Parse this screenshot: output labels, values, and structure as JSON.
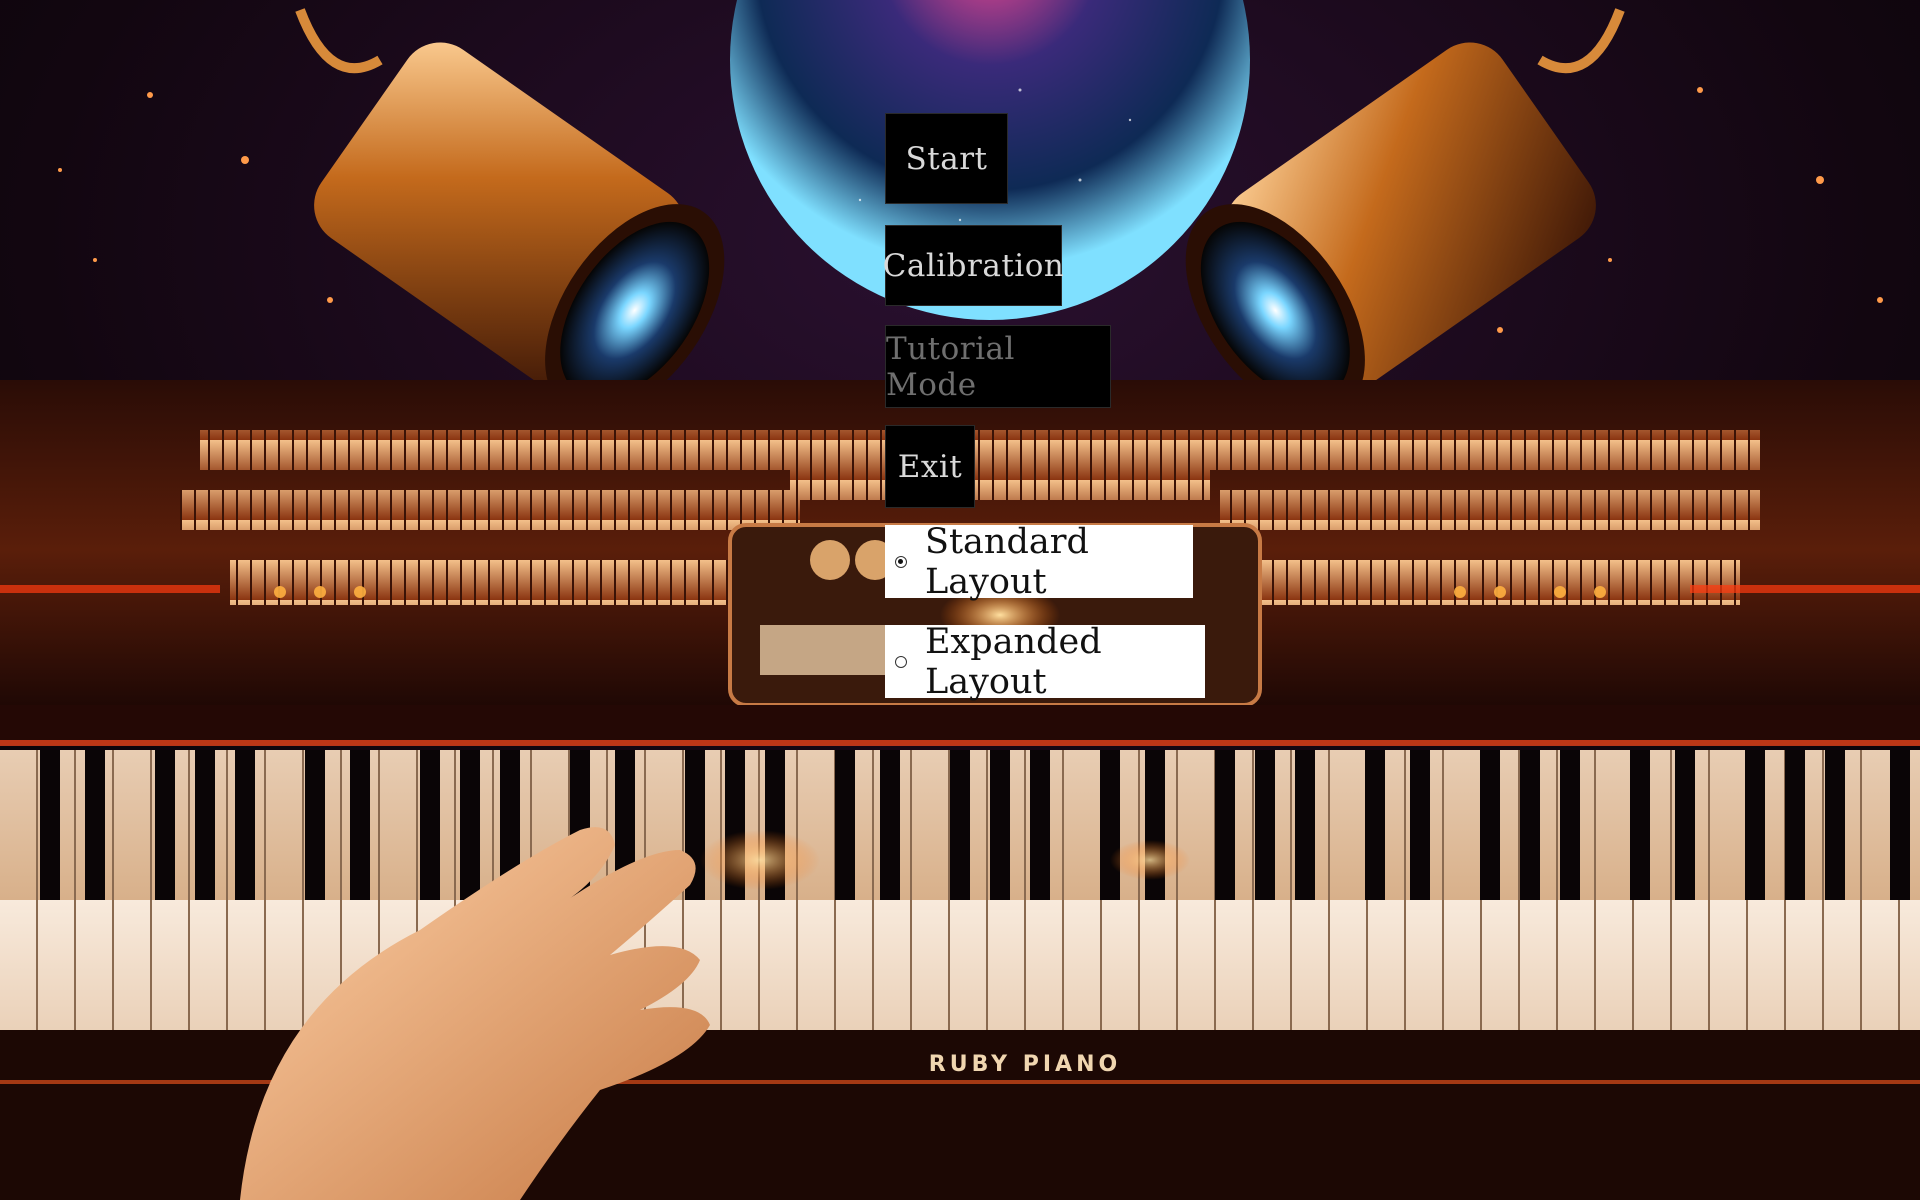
{
  "menu": {
    "start_label": "Start",
    "calibration_label": "Calibration",
    "tutorial_label": "Tutorial Mode",
    "exit_label": "Exit"
  },
  "layout_options": [
    {
      "label": "Standard Layout",
      "selected": true
    },
    {
      "label": "Expanded Layout",
      "selected": false
    }
  ],
  "brand": {
    "piano_name": "RUBY PIANO"
  },
  "colors": {
    "button_bg": "#000000",
    "button_text": "#d9d9d9",
    "button_text_disabled": "#6f6f6f",
    "radio_bg": "#ffffff",
    "piano_glow": "#ff7a1a"
  }
}
